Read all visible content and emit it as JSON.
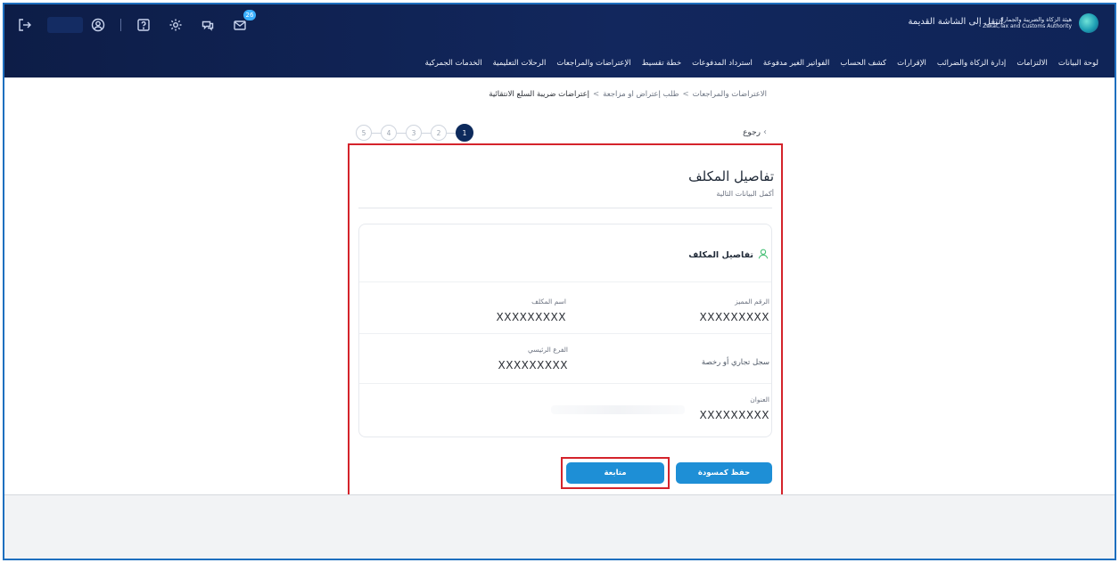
{
  "header": {
    "brand_ar": "هيئة الزكاة والضريبة والجمارك",
    "brand_en": "Zakat,Tax and Customs Authority",
    "old_screen_link": "انتقل إلى الشاشة القديمة",
    "mail_badge": "26",
    "icons": [
      "logout-icon",
      "user-circle-icon",
      "help-icon",
      "settings-icon",
      "chat-icon",
      "mail-icon"
    ]
  },
  "nav": {
    "items": [
      "لوحة البيانات",
      "الالتزامات",
      "إدارة الزكاة والضرائب",
      "الإقرارات",
      "كشف الحساب",
      "الفواتير الغير مدفوعة",
      "استرداد المدفوعات",
      "خطة تقسيط",
      "الإعتراضات والمراجعات",
      "الرحلات التعليمية",
      "الخدمات الجمركية"
    ]
  },
  "breadcrumb": {
    "items": [
      "الاعتراضات والمراجعات",
      "طلب إعتراض او مزاجعة",
      "إعتراضات ضريبة السلع الانتقائية"
    ],
    "separator": ">"
  },
  "back_label": "رجوع",
  "stepper": {
    "steps": [
      "1",
      "2",
      "3",
      "4",
      "5"
    ],
    "active": "1"
  },
  "form": {
    "title": "تفاصيل المكلف",
    "subtitle": "أكمل البيانات التالية",
    "card": {
      "heading": "تفاصيل المكلف",
      "fields": {
        "distinguished_number": {
          "label": "الرقم المميز",
          "value": "XXXXXXXXX"
        },
        "taxpayer_name": {
          "label": "اسم المكلف",
          "value": "XXXXXXXXX"
        },
        "commercial_register": {
          "label": "سجل تجاري أو رخصة"
        },
        "main_branch": {
          "label": "الفرع الرئيسي",
          "value": "XXXXXXXXX"
        },
        "address": {
          "label": "العنوان",
          "value": "XXXXXXXXX"
        }
      }
    },
    "buttons": {
      "save_draft": "حفظ كمسودة",
      "continue": "متابعة"
    }
  },
  "colors": {
    "header_dark": "#0d1d47",
    "accent_button": "#1e8fd6",
    "highlight_red": "#d4232b",
    "active_step": "#0d2a5c"
  }
}
